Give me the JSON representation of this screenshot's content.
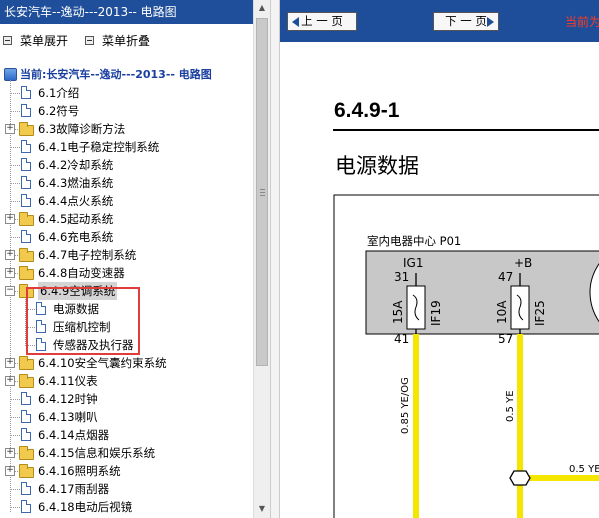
{
  "sidebar": {
    "title": "长安汽车--逸动---2013-- 电路图",
    "toolbar": {
      "expand_label": "菜单展开",
      "collapse_label": "菜单折叠"
    },
    "tree": {
      "root_label": "当前:长安汽车--逸动---2013-- 电路图",
      "items": [
        {
          "label": "6.1介绍",
          "type": "doc",
          "level": 1
        },
        {
          "label": "6.2符号",
          "type": "doc",
          "level": 1
        },
        {
          "label": "6.3故障诊断方法",
          "type": "folder",
          "level": 1,
          "expander": "+"
        },
        {
          "label": "6.4.1电子稳定控制系统",
          "type": "doc",
          "level": 1
        },
        {
          "label": "6.4.2冷却系统",
          "type": "doc",
          "level": 1
        },
        {
          "label": "6.4.3燃油系统",
          "type": "doc",
          "level": 1
        },
        {
          "label": "6.4.4点火系统",
          "type": "doc",
          "level": 1
        },
        {
          "label": "6.4.5起动系统",
          "type": "folder",
          "level": 1,
          "expander": "+"
        },
        {
          "label": "6.4.6充电系统",
          "type": "doc",
          "level": 1
        },
        {
          "label": "6.4.7电子控制系统",
          "type": "folder",
          "level": 1,
          "expander": "+"
        },
        {
          "label": "6.4.8自动变速器",
          "type": "folder",
          "level": 1,
          "expander": "+"
        },
        {
          "label": "6.4.9空调系统",
          "type": "folder",
          "level": 1,
          "expander": "−",
          "selected": true
        },
        {
          "label": "电源数据",
          "type": "doc",
          "level": 2
        },
        {
          "label": "压缩机控制",
          "type": "doc",
          "level": 2
        },
        {
          "label": "传感器及执行器",
          "type": "doc",
          "level": 2
        },
        {
          "label": "6.4.10安全气囊约束系统",
          "type": "folder",
          "level": 1,
          "expander": "+"
        },
        {
          "label": "6.4.11仪表",
          "type": "folder",
          "level": 1,
          "expander": "+"
        },
        {
          "label": "6.4.12时钟",
          "type": "doc",
          "level": 1
        },
        {
          "label": "6.4.13喇叭",
          "type": "doc",
          "level": 1
        },
        {
          "label": "6.4.14点烟器",
          "type": "doc",
          "level": 1
        },
        {
          "label": "6.4.15信息和娱乐系统",
          "type": "folder",
          "level": 1,
          "expander": "+"
        },
        {
          "label": "6.4.16照明系统",
          "type": "folder",
          "level": 1,
          "expander": "+"
        },
        {
          "label": "6.4.17雨刮器",
          "type": "doc",
          "level": 1
        },
        {
          "label": "6.4.18电动后视镜",
          "type": "doc",
          "level": 1
        }
      ]
    }
  },
  "topbar": {
    "prev_label": "上 一 页",
    "next_label": "下 一 页",
    "current_label": "当前为"
  },
  "document": {
    "section_number": "6.4.9-1",
    "title": "电源数据",
    "diagram": {
      "module_label": "室内电器中心  P01",
      "fuses": [
        {
          "top_label": "IG1",
          "top_pin": "31",
          "rating": "15A",
          "name": "IF19",
          "bottom_pin": "41",
          "wire_label": "0.85 YE/OG"
        },
        {
          "top_label": "+B",
          "top_pin": "47",
          "rating": "10A",
          "name": "IF25",
          "bottom_pin": "57",
          "wire_label": "0.5 YE"
        }
      ],
      "branch_wire_label": "0.5 YE",
      "wire_color": "#f5e600",
      "module_fill": "#c8c8c8"
    }
  },
  "colors": {
    "title_bar": "#1f4f9a",
    "top_bar": "#1e4e99",
    "highlight_box": "#e23b3b",
    "current_text": "#ff3a1f"
  }
}
